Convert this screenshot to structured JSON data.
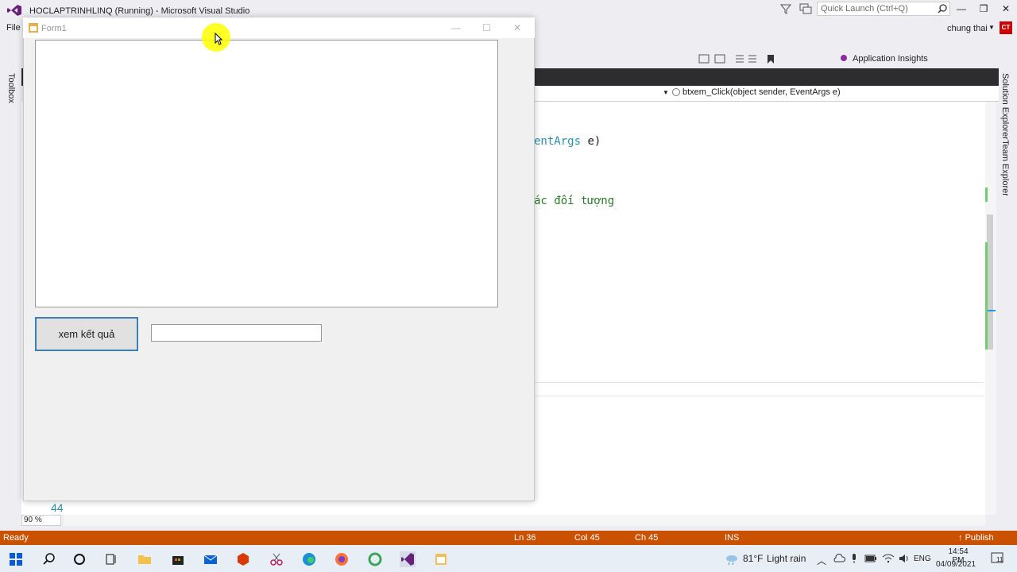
{
  "vs": {
    "title": "HOCLAPTRINHLINQ (Running) - Microsoft Visual Studio",
    "quick_launch_placeholder": "Quick Launch (Ctrl+Q)",
    "menu_file": "File",
    "user_name": "chung thai",
    "user_initials": "CT",
    "app_insights": "Application Insights",
    "toolbox_label": "Toolbox",
    "solution_explorer_label": "Solution Explorer",
    "team_explorer_label": "Team Explorer",
    "nav_method": "btxem_Click(object sender, EventArgs e)",
    "code_line1_type": "entArgs",
    "code_line1_rest": " e)",
    "code_line2": "ác đối tượng",
    "line_number": "44",
    "zoom": "90 %"
  },
  "status_bar": {
    "ready": "Ready",
    "ln": "Ln 36",
    "col": "Col 45",
    "ch": "Ch 45",
    "ins": "INS",
    "publish": "Publish"
  },
  "taskbar": {
    "temperature": "81°F",
    "weather": "Light rain",
    "language": "ENG",
    "time": "14:54 PM",
    "date": "04/09/2021",
    "notification_count": "11"
  },
  "form": {
    "title": "Form1",
    "button_label": "xem kết quả",
    "input_value": ""
  },
  "colors": {
    "status_bar": "#ca5100",
    "editor_frame": "#2d2d30",
    "button_border": "#3c7fb1"
  }
}
